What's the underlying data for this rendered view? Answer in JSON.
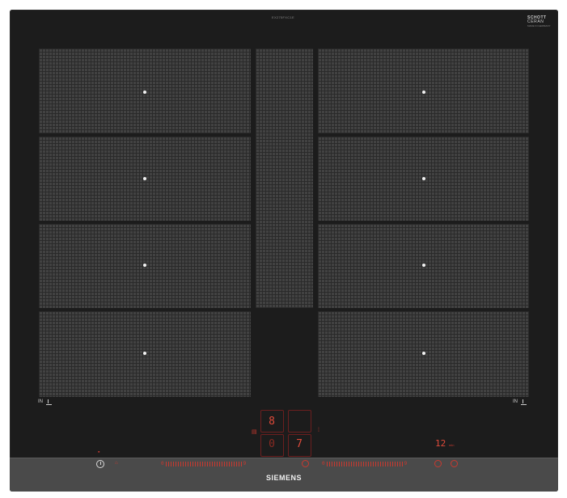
{
  "cooktop": {
    "model_label": "EX275FXC1E",
    "glass_brand": {
      "line1": "SCHOTT",
      "line2": "CERAN",
      "line3": "MADE IN GERMANY"
    },
    "brand": "SIEMENS"
  },
  "indicators": {
    "in_left": "IN",
    "in_right": "IN"
  },
  "displays": {
    "zone_top_left": "8",
    "zone_bottom_left": "0",
    "zone_bottom_right": "7",
    "timer_value": "12",
    "timer_unit": "min"
  },
  "sliders": {
    "left_start": "0",
    "left_end": "9",
    "right_start": "0",
    "right_end": "9"
  },
  "colors": {
    "glass": "#1c1c1c",
    "zone_fill": "#424242",
    "control_strip": "#4a4a4a",
    "display_red": "#e04a3a"
  }
}
